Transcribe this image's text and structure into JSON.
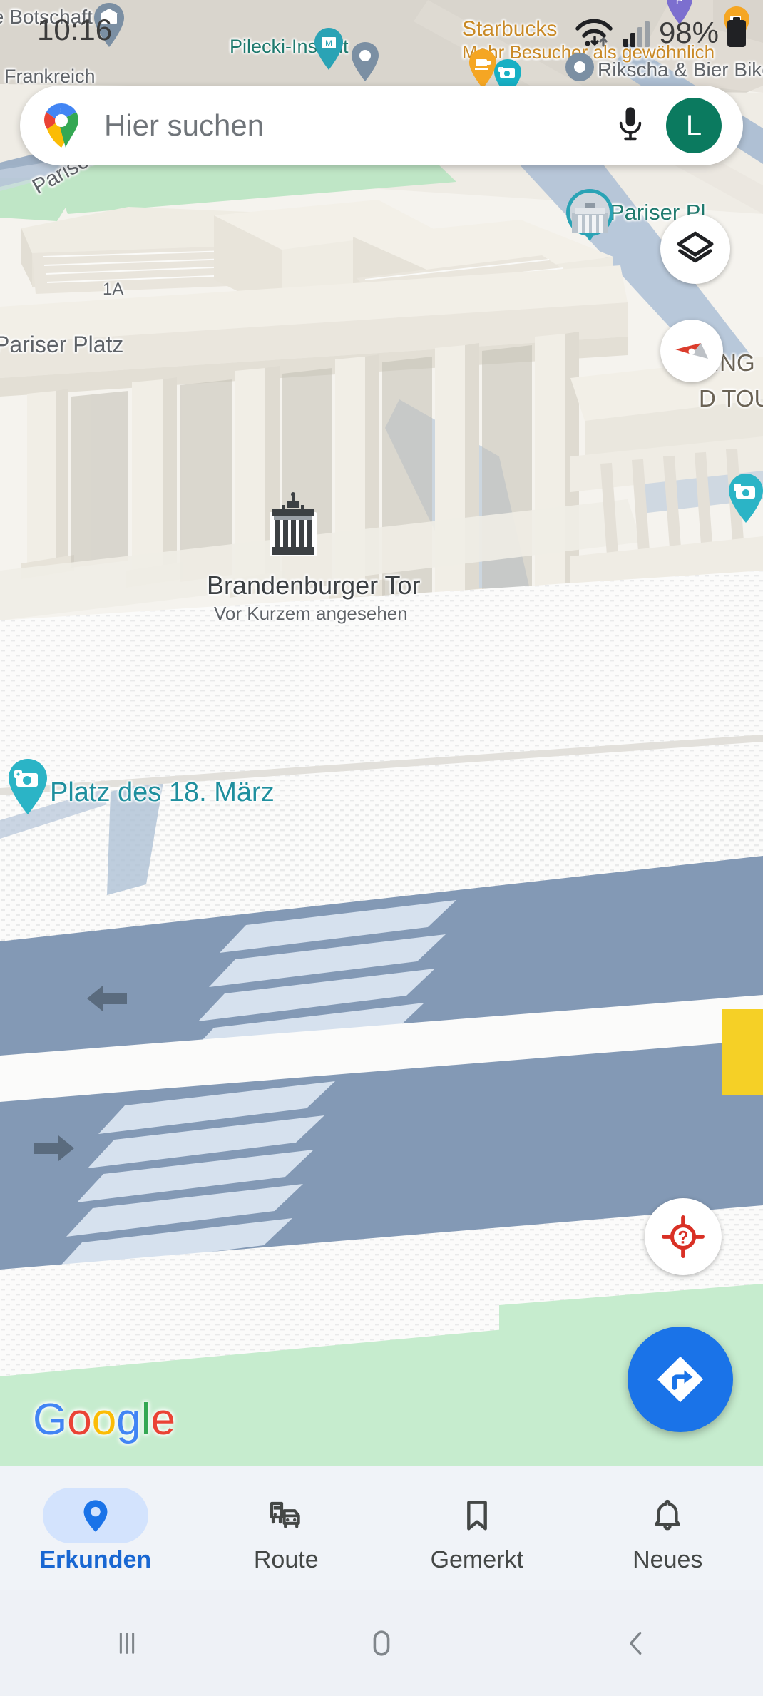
{
  "app": {
    "name": "Google Maps",
    "platform": "Android"
  },
  "status_bar": {
    "time": "10:16",
    "battery_percent": "98%",
    "icons": [
      "wifi-icon",
      "cellular-signal-icon",
      "battery-icon"
    ]
  },
  "search": {
    "placeholder": "Hier suchen",
    "logo": "google-maps-pin-logo",
    "mic_icon": "microphone-icon",
    "avatar_initial": "L"
  },
  "map": {
    "labels": [
      {
        "id": "frankreich",
        "text": "ische Botschaft",
        "kind": "poi"
      },
      {
        "id": "frankreich2",
        "text": "Frankreich",
        "kind": "poi"
      },
      {
        "id": "pilecki",
        "text": "Pilecki-Institut",
        "kind": "poi"
      },
      {
        "id": "starbucks",
        "text": "Starbucks",
        "kind": "poi"
      },
      {
        "id": "starbucks_sub",
        "text": "Mehr Besucher als gewöhnlich",
        "kind": "poi-sub"
      },
      {
        "id": "rikscha",
        "text": "Rikscha & Bier Bike",
        "kind": "poi"
      },
      {
        "id": "pariser_platz_street",
        "text": "Pariser Platz",
        "kind": "street"
      },
      {
        "id": "pariser_platz_h",
        "text": "Pariser Platz",
        "kind": "street"
      },
      {
        "id": "house_number",
        "text": "1A",
        "kind": "address"
      },
      {
        "id": "pariser_platz_poi",
        "text": "Pariser Pl",
        "kind": "poi"
      },
      {
        "id": "tour_line1",
        "text": "ING",
        "kind": "poi"
      },
      {
        "id": "tour_line2",
        "text": "D TOU",
        "kind": "poi"
      },
      {
        "id": "brandenburger_tor",
        "text": "Brandenburger Tor",
        "kind": "landmark"
      },
      {
        "id": "brandenburger_sub",
        "text": "Vor Kurzem angesehen",
        "kind": "landmark-sub"
      },
      {
        "id": "platz18",
        "text": "Platz des 18. März",
        "kind": "poi"
      }
    ],
    "attribution": {
      "text": "Google",
      "letters": [
        "G",
        "o",
        "o",
        "g",
        "l",
        "e"
      ]
    },
    "colors": {
      "land": "#f6f4ef",
      "building": "#ece8df",
      "road": "#8399b5",
      "road_white": "#fbfbfa",
      "park": "#bfe6c6",
      "water": "#aac4dd",
      "label_teal": "#1f8f9e",
      "accent_blue": "#1a73e8"
    },
    "controls": [
      {
        "id": "layers",
        "icon": "layers-icon",
        "label": "Ebenen"
      },
      {
        "id": "compass",
        "icon": "compass-icon",
        "label": "Kompass"
      },
      {
        "id": "locate",
        "icon": "location-unknown-icon",
        "label": "Mein Standort"
      },
      {
        "id": "directions_fab",
        "icon": "directions-icon",
        "label": "Route"
      }
    ]
  },
  "bottom_nav": {
    "items": [
      {
        "id": "erkunden",
        "label": "Erkunden",
        "icon": "map-pin-icon",
        "active": true
      },
      {
        "id": "route",
        "label": "Route",
        "icon": "transit-car-icon",
        "active": false
      },
      {
        "id": "gemerkt",
        "label": "Gemerkt",
        "icon": "bookmark-icon",
        "active": false
      },
      {
        "id": "neues",
        "label": "Neues",
        "icon": "bell-icon",
        "active": false
      }
    ]
  },
  "android_nav": {
    "items": [
      {
        "id": "recents",
        "icon": "recents-icon"
      },
      {
        "id": "home",
        "icon": "home-icon"
      },
      {
        "id": "back",
        "icon": "back-icon"
      }
    ]
  }
}
